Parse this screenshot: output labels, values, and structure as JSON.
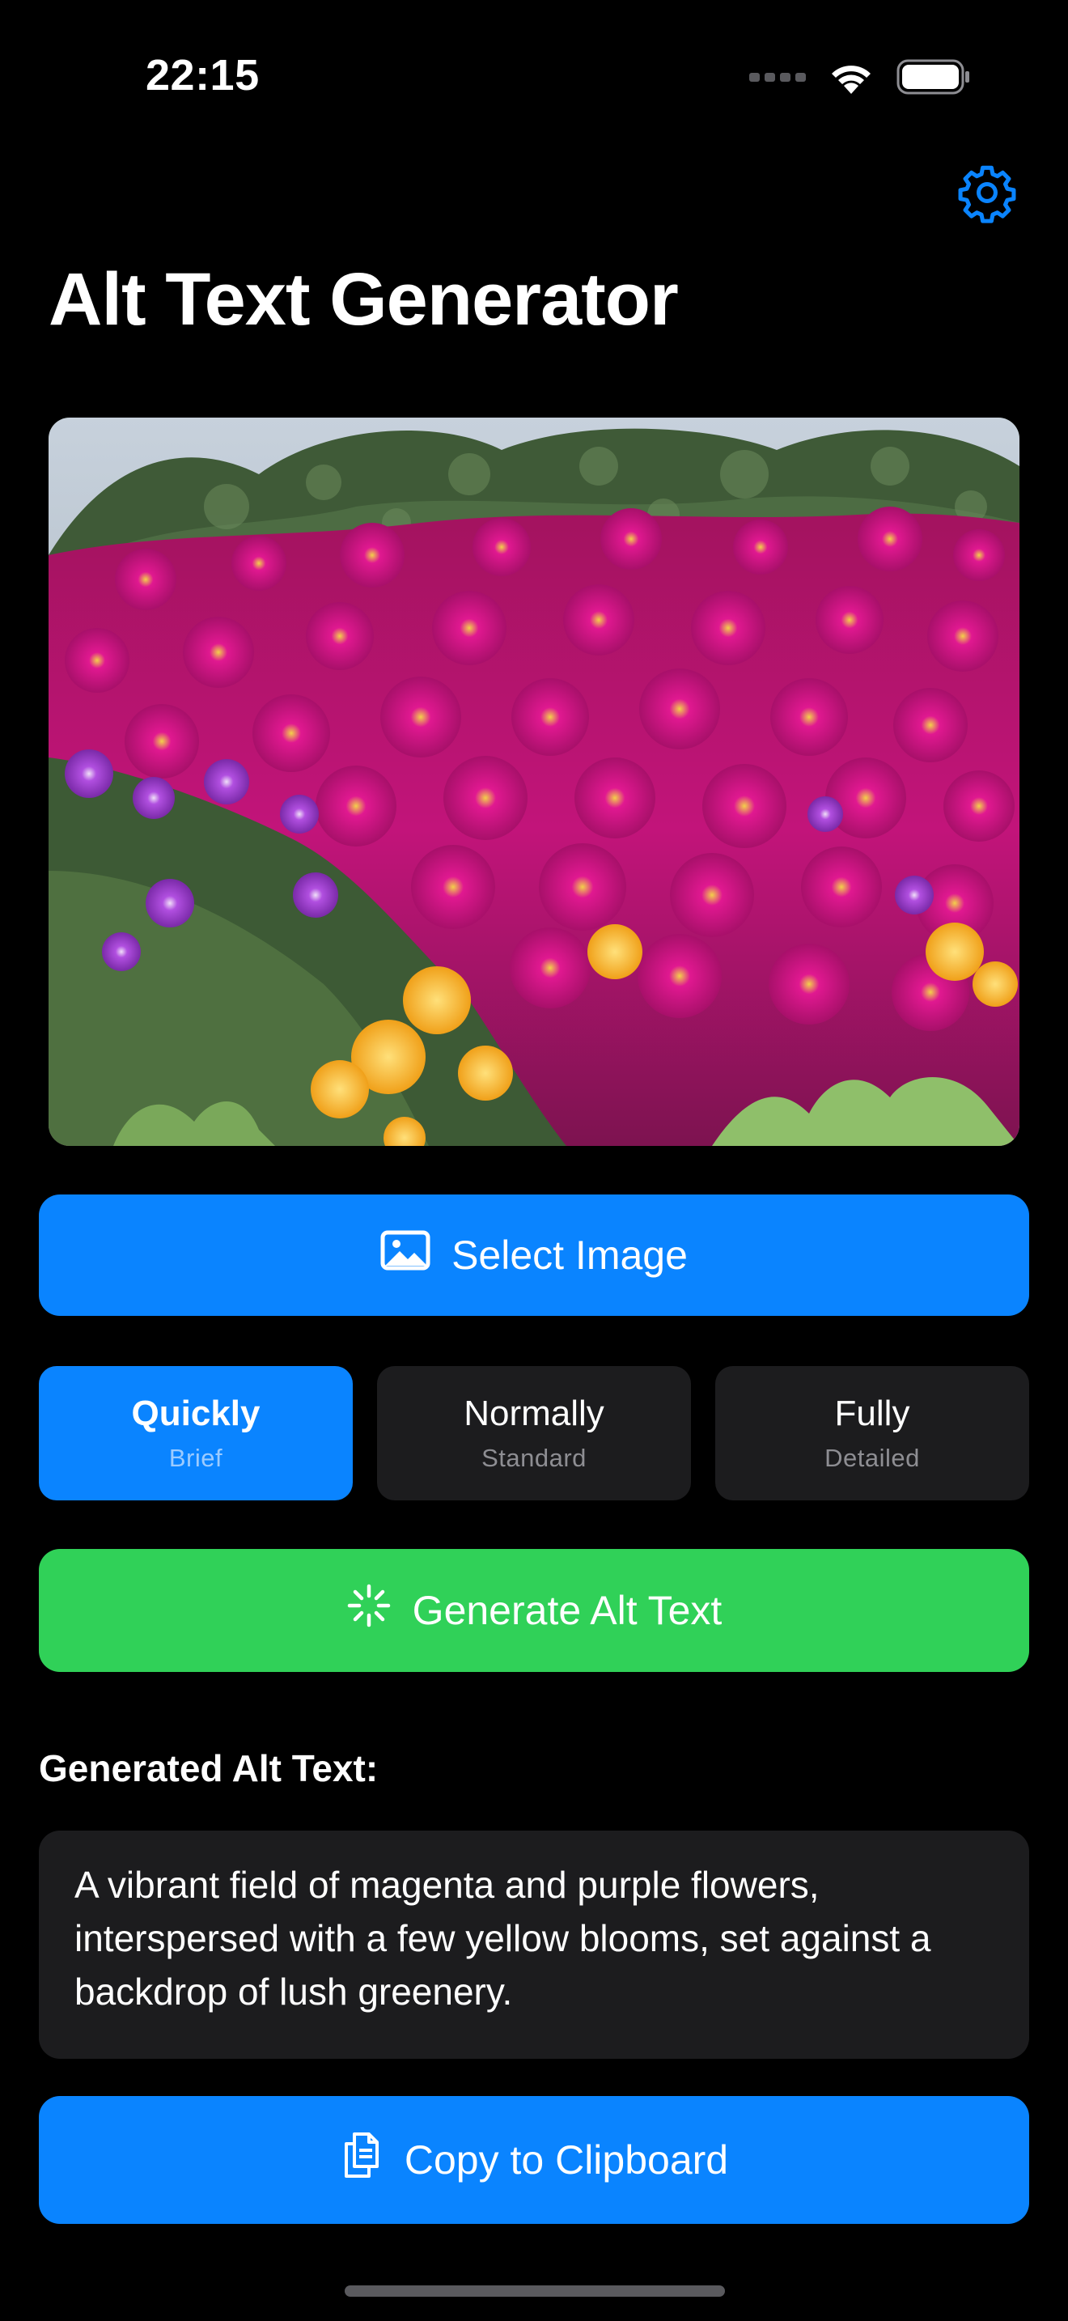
{
  "status_bar": {
    "time": "22:15",
    "icons": [
      "cellular-signal-icon",
      "wifi-icon",
      "battery-icon"
    ]
  },
  "header": {
    "title": "Alt Text Generator",
    "settings_icon": "gear-icon"
  },
  "image_preview": {
    "description_icon": "photo"
  },
  "select_image": {
    "label": "Select Image",
    "icon": "photo-icon"
  },
  "modes": [
    {
      "title": "Quickly",
      "subtitle": "Brief",
      "selected": true
    },
    {
      "title": "Normally",
      "subtitle": "Standard",
      "selected": false
    },
    {
      "title": "Fully",
      "subtitle": "Detailed",
      "selected": false
    }
  ],
  "generate": {
    "label": "Generate Alt Text",
    "icon": "sparkle-icon"
  },
  "result": {
    "heading": "Generated Alt Text:",
    "text": "A vibrant field of magenta and purple flowers, interspersed with a few yellow blooms, set against a backdrop of lush greenery."
  },
  "copy": {
    "label": "Copy to Clipboard",
    "icon": "copy-documents-icon"
  },
  "colors": {
    "background": "#000000",
    "accent_blue": "#0a84ff",
    "accent_green": "#30d158",
    "card": "#1c1c1e",
    "secondary_text": "#8e8e93"
  }
}
